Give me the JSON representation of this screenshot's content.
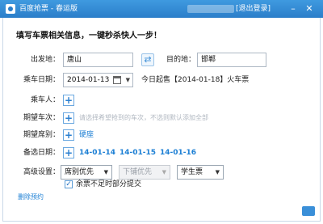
{
  "window": {
    "title": "百度抢票 - 春运版",
    "logout": "[退出登录]",
    "minimize": "–",
    "close": "✕"
  },
  "heading": "填写车票相关信息，一键秒杀快人一步！",
  "route": {
    "from_label": "出发地：",
    "from_value": "唐山",
    "swap_icon": "⇄",
    "to_label": "目的地：",
    "to_value": "邯郸"
  },
  "date": {
    "label": "乘车日期：",
    "value": "2014-01-13",
    "today_hint": "今日起售【2014-01-18】火车票"
  },
  "passenger": {
    "label": "乘车人："
  },
  "trains": {
    "label": "期望车次：",
    "hint": "请选择希望抢到的车次，不选则默认添加全部"
  },
  "seats": {
    "label": "期望席别：",
    "value": "硬座"
  },
  "backup_dates": {
    "label": "备选日期：",
    "dates": [
      "14-01-14",
      "14-01-15",
      "14-01-16"
    ]
  },
  "advanced": {
    "label": "高级设置：",
    "select1": "席别优先",
    "select2": "下铺优先",
    "select3": "学生票",
    "checkbox_label": "余票不足时部分提交",
    "checkbox_checked": true
  },
  "delete_link": "删除预约",
  "plus_symbol": "+",
  "check_mark": "✓",
  "arrow_symbol": "▼",
  "colors": {
    "titlebar": "#2b7ec9",
    "link": "#1c7fd4"
  }
}
